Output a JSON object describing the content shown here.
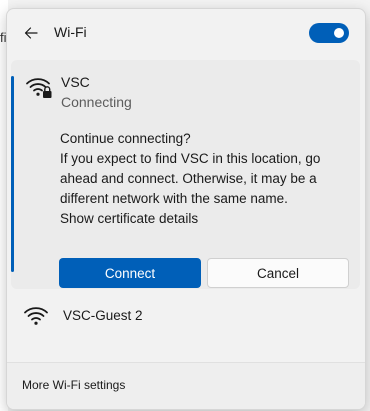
{
  "background": {
    "partial_text": "fi"
  },
  "header": {
    "title": "Wi-Fi",
    "toggle_state": "on",
    "accent_color": "#005fb8"
  },
  "connecting_network": {
    "name": "VSC",
    "status": "Connecting",
    "icon": "wifi-secured-icon",
    "message": {
      "question": "Continue connecting?",
      "lines": [
        "If you expect to find VSC in this location, go",
        "ahead and connect. Otherwise, it may be a",
        "different network with the same name."
      ],
      "certificate_link": "Show certificate details"
    },
    "connect_label": "Connect",
    "cancel_label": "Cancel"
  },
  "networks": [
    {
      "name": "VSC-Guest 2",
      "icon": "wifi-icon"
    }
  ],
  "footer": {
    "settings_link": "More Wi-Fi settings"
  }
}
